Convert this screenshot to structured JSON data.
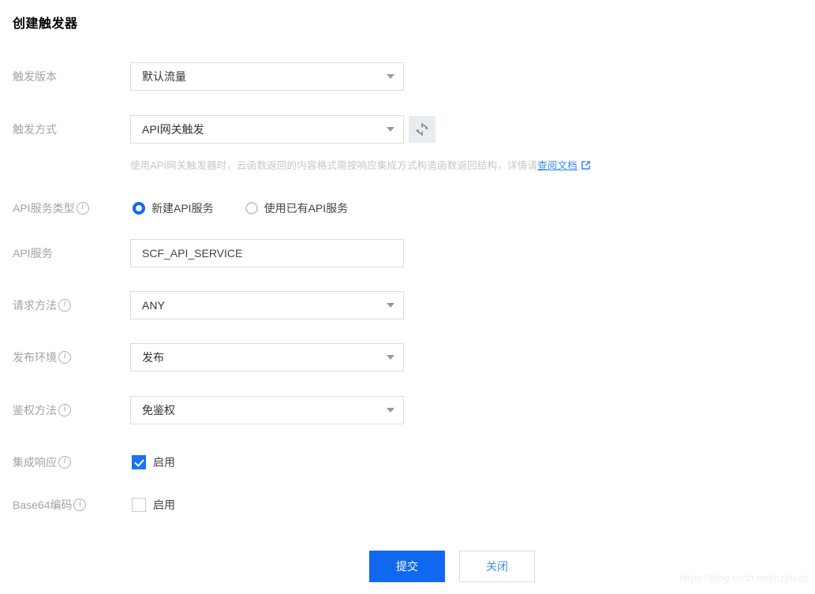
{
  "page": {
    "title": "创建触发器",
    "watermark": "https://blog.csdn.net/nzjdsds"
  },
  "colors": {
    "accent": "#1068f0",
    "link": "#3a8bfd",
    "label": "#a3a3a3",
    "hint": "#c6c6c6",
    "border": "#dddddd"
  },
  "fields": {
    "trigger_version": {
      "label": "触发版本",
      "value": "默认流量",
      "has_info": false
    },
    "trigger_type": {
      "label": "触发方式",
      "value": "API网关触发",
      "has_info": false,
      "refresh_icon": "refresh-icon"
    },
    "api_service_type": {
      "label": "API服务类型",
      "has_info": true,
      "options": [
        {
          "label": "新建API服务",
          "checked": true
        },
        {
          "label": "使用已有API服务",
          "checked": false
        }
      ]
    },
    "api_service": {
      "label": "API服务",
      "value": "SCF_API_SERVICE",
      "has_info": false
    },
    "request_method": {
      "label": "请求方法",
      "value": "ANY",
      "has_info": true
    },
    "release_env": {
      "label": "发布环境",
      "value": "发布",
      "has_info": true
    },
    "auth_method": {
      "label": "鉴权方法",
      "value": "免鉴权",
      "has_info": true
    },
    "integrated_response": {
      "label": "集成响应",
      "has_info": true,
      "checkbox_label": "启用",
      "checked": true
    },
    "base64_encoding": {
      "label": "Base64编码",
      "has_info": true,
      "checkbox_label": "启用",
      "checked": false
    }
  },
  "hint": {
    "text_before": "使用API网关触发器时，云函数返回的内容格式需按响应集成方式构造函数返回结构，详情请",
    "link_text": "查阅文档"
  },
  "buttons": {
    "submit": "提交",
    "close": "关闭"
  }
}
